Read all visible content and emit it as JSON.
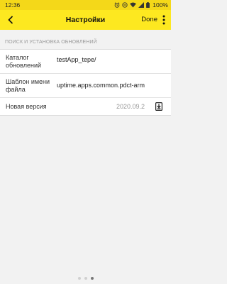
{
  "status_bar": {
    "time": "12:36",
    "battery": "100%"
  },
  "app_bar": {
    "title": "Настройки",
    "done_label": "Done",
    "accent_color": "#fde820"
  },
  "section": {
    "header": "ПОИСК И УСТАНОВКА ОБНОВЛЕНИЙ"
  },
  "settings": {
    "catalog": {
      "label": "Каталог обновлений",
      "value": "testApp_tepe/"
    },
    "filename_template": {
      "label": "Шаблон имени файла",
      "value": "uptime.apps.common.pdct-arm"
    },
    "new_version": {
      "label": "Новая версия",
      "value": "2020.09.2"
    }
  },
  "pager": {
    "count": 3,
    "active_index": 2
  }
}
